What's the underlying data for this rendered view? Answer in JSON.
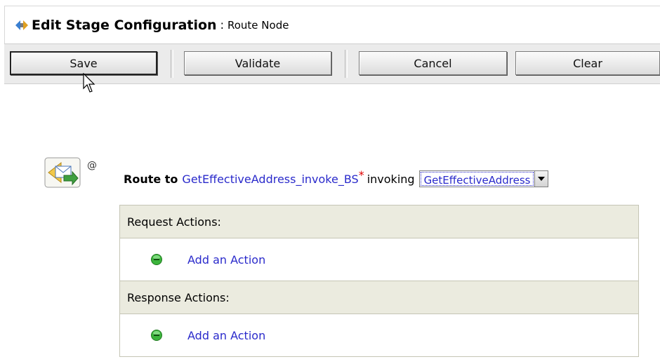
{
  "header": {
    "title": "Edit Stage Configuration",
    "separator": ":",
    "subtitle": "Route Node",
    "icon": "stage-config-icon"
  },
  "toolbar": {
    "save_label": "Save",
    "validate_label": "Validate",
    "cancel_label": "Cancel",
    "clear_label": "Clear"
  },
  "route": {
    "label": "Route to",
    "service": "GetEffectiveAddress_invoke_BS",
    "required_mark": "*",
    "invoking_label": "invoking",
    "operation": "GetEffectiveAddress",
    "at_sign": "@"
  },
  "request_section": {
    "header": "Request Actions:",
    "add_action_label": "Add an Action"
  },
  "response_section": {
    "header": "Response Actions:",
    "add_action_label": "Add an Action"
  },
  "colors": {
    "link": "#2a2acb",
    "section_header_bg": "#ebebdf",
    "add_icon": "#3cb43c",
    "required": "#e00000"
  }
}
